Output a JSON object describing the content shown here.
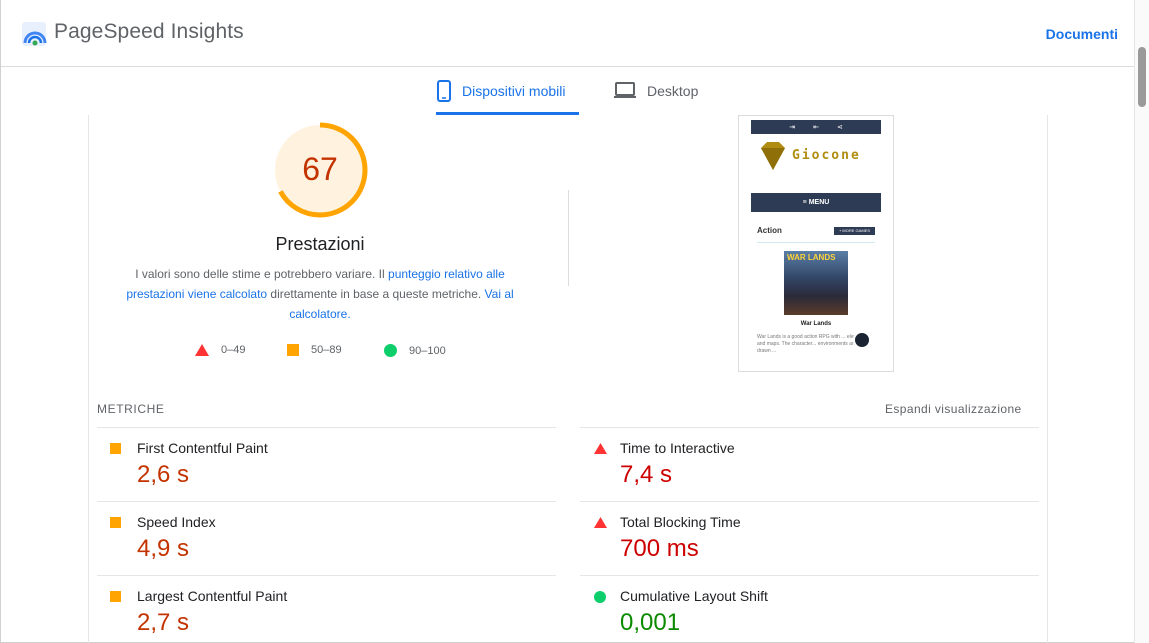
{
  "header": {
    "brand": "PageSpeed Insights",
    "docs_link": "Documenti"
  },
  "tabs": [
    {
      "label": "Dispositivi mobili",
      "active": true
    },
    {
      "label": "Desktop",
      "active": false
    }
  ],
  "performance": {
    "score": "67",
    "score_fraction": 0.67,
    "title": "Prestazioni",
    "desc_part1": "I valori sono delle stime e potrebbero variare. Il ",
    "desc_link1": "punteggio relativo alle prestazioni viene calcolato",
    "desc_part2": " direttamente in base a queste metriche. ",
    "desc_link2": "Vai al calcolatore.",
    "legend": [
      {
        "range": "0–49",
        "shape": "triangle",
        "color": "#ff3333"
      },
      {
        "range": "50–89",
        "shape": "square",
        "color": "#ffa400"
      },
      {
        "range": "90–100",
        "shape": "circle",
        "color": "#0cce6b"
      }
    ]
  },
  "thumbnail": {
    "site_name": "Giocone",
    "menu": "≡ MENU",
    "section": "Action",
    "more_button": "+ MORE GAMES",
    "image_label": "WAR LANDS",
    "game_title": "War Lands",
    "game_text": "War Lands is a good action RPG with ... elements and maps. The character... environments are hand drawn ..."
  },
  "metrics": {
    "title": "METRICHE",
    "expand": "Espandi visualizzazione",
    "items": [
      {
        "label": "First Contentful Paint",
        "value": "2,6 s",
        "status": "orange"
      },
      {
        "label": "Time to Interactive",
        "value": "7,4 s",
        "status": "red"
      },
      {
        "label": "Speed Index",
        "value": "4,9 s",
        "status": "orange"
      },
      {
        "label": "Total Blocking Time",
        "value": "700 ms",
        "status": "red"
      },
      {
        "label": "Largest Contentful Paint",
        "value": "2,7 s",
        "status": "orange"
      },
      {
        "label": "Cumulative Layout Shift",
        "value": "0,001",
        "status": "green"
      }
    ]
  },
  "colors": {
    "accent": "#1a73e8",
    "orange": "#ffa400",
    "red": "#ff3333",
    "green": "#0cce6b"
  }
}
